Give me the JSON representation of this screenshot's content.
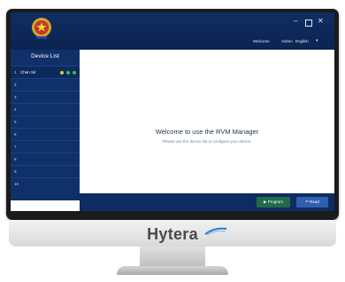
{
  "header": {
    "welcome": "Welcome",
    "user": "Admin",
    "language": "English",
    "icons": [
      "police-emblem-icon",
      "minimize-icon",
      "maximize-icon",
      "close-icon"
    ]
  },
  "sidebar": {
    "title": "Device List",
    "items": [
      {
        "num": "1",
        "name": "Chen Sir"
      },
      {
        "num": "2",
        "name": ""
      },
      {
        "num": "3",
        "name": ""
      },
      {
        "num": "4",
        "name": ""
      },
      {
        "num": "5",
        "name": ""
      },
      {
        "num": "6",
        "name": ""
      },
      {
        "num": "7",
        "name": ""
      },
      {
        "num": "8",
        "name": ""
      },
      {
        "num": "9",
        "name": ""
      },
      {
        "num": "10",
        "name": ""
      }
    ]
  },
  "main": {
    "title": "Welcome to use the RVM Manager",
    "subtitle": "Please use the device list to configure your device."
  },
  "footer": {
    "program_label": "Program",
    "read_label": "Read"
  },
  "brand": "Hytera",
  "colors": {
    "header_bg": "#0f2e63",
    "sidebar_bg": "#10306a",
    "program_button": "#1f6b4a",
    "read_button": "#2f5fb0"
  }
}
